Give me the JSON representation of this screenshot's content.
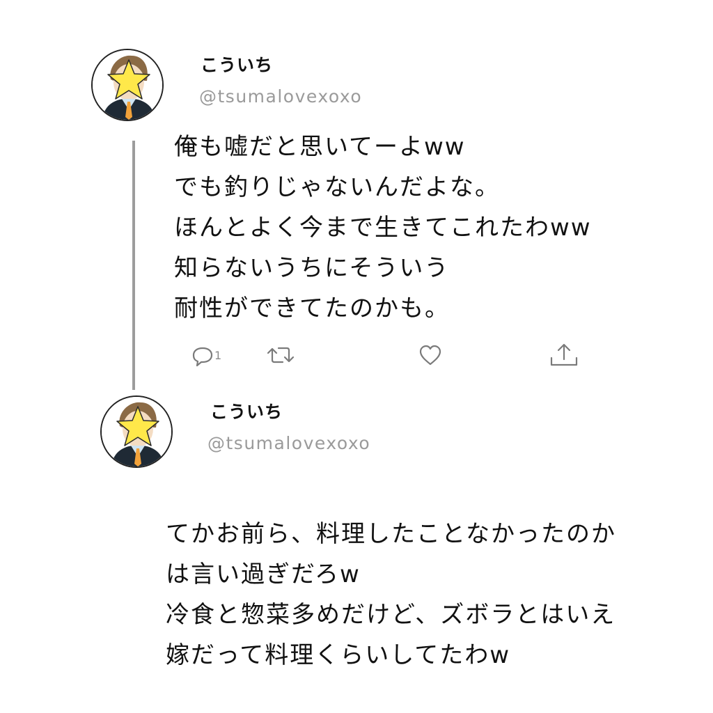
{
  "thread": [
    {
      "author": {
        "display_name": "こういち",
        "handle": "@tsumalovexoxo",
        "avatar_icon": "avatar-star-masked-icon"
      },
      "lines": [
        "俺も嘘だと思いてーよww",
        "でも釣りじゃないんだよな。",
        "ほんとよく今まで生きてこれたわww",
        "知らないうちにそういう",
        "耐性ができてたのかも。"
      ],
      "actions": {
        "reply_count": "1",
        "icons": [
          "reply-icon",
          "retweet-icon",
          "like-icon",
          "share-icon"
        ]
      }
    },
    {
      "author": {
        "display_name": "こういち",
        "handle": "@tsumalovexoxo",
        "avatar_icon": "avatar-star-masked-icon"
      },
      "lines": [
        "てかお前ら、料理したことなかったのか",
        "は言い過ぎだろw",
        "冷食と惣菜多めだけど、ズボラとはいえ",
        "嫁だって料理くらいしてたわw"
      ]
    }
  ],
  "colors": {
    "text": "#111111",
    "handle": "#9a9a9a",
    "thread_line": "#9c9c9c",
    "star": "#ffe84a",
    "star_outline": "#2a2a2a",
    "tie": "#f2a23a",
    "suit": "#1f2a35",
    "hair": "#8b6a45"
  }
}
